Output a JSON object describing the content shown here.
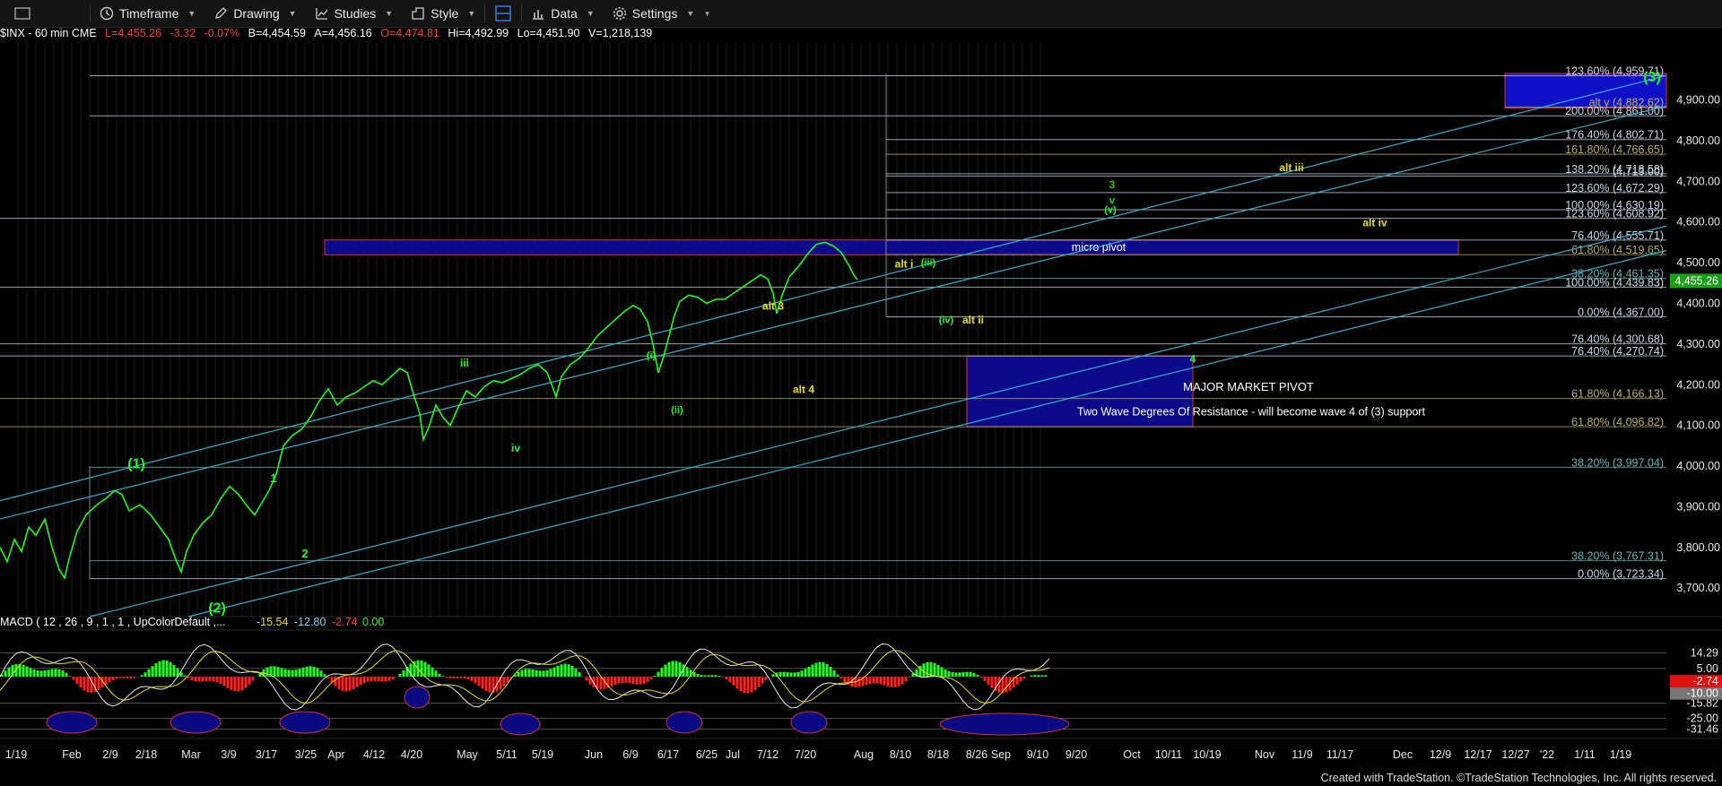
{
  "toolbar": {
    "items": [
      {
        "label": "Timeframe",
        "icon": "clock-icon"
      },
      {
        "label": "Drawing",
        "icon": "pencil-icon"
      },
      {
        "label": "Studies",
        "icon": "studies-icon"
      },
      {
        "label": "Style",
        "icon": "style-icon"
      },
      {
        "label": "Data",
        "icon": "data-icon"
      },
      {
        "label": "Settings",
        "icon": "gear-icon"
      }
    ]
  },
  "header": {
    "symbol": "$INX - 60 min  CME",
    "last": "L=4,455.26",
    "chg": "-3.32",
    "pct": "-0.07%",
    "bid": "B=4,454.59",
    "ask": "A=4,456.16",
    "open": "O=4,474.81",
    "high": "Hi=4,492.99",
    "low": "Lo=4,451.90",
    "vol": "V=1,218,139"
  },
  "macd_header": {
    "title": "MACD ( 12 , 26 , 9 , 1 , 1 , UpColorDefault ,... ",
    "v1": "-15.54",
    "v2": "-12.80",
    "v3": "-2.74",
    "v4": "0.00"
  },
  "footer": "Created with TradeStation. ©TradeStation Technologies, Inc. All rights reserved.",
  "colors": {
    "price": "#19ff19",
    "channel": "#2fb0d0",
    "fib": "#7fd4e0",
    "box": "#0a0a8a",
    "box_border": "#d33",
    "yellow": "#e8e000",
    "macd": "#e8e000"
  },
  "chart_data": {
    "type": "line",
    "title": "$INX - 60 min",
    "y_axis": {
      "ticks": [
        3700,
        3800,
        3900,
        4000,
        4100,
        4200,
        4300,
        4400,
        4500,
        4600,
        4700,
        4800,
        4900
      ],
      "tick_labels": [
        "3,700.00",
        "3,800.00",
        "3,900.00",
        "4,000.00",
        "4,100.00",
        "4,200.00",
        "4,300.00",
        "4,400.00",
        "4,500.00",
        "4,600.00",
        "4,700.00",
        "4,800.00",
        "4,900.00"
      ],
      "range": [
        3630,
        5040
      ],
      "last_price": 4455.26,
      "last_label": "4,455.26"
    },
    "x_axis": {
      "labels": [
        "1/19",
        "Feb",
        "2/9",
        "2/18",
        "Mar",
        "3/9",
        "3/17",
        "3/25",
        "Apr",
        "4/12",
        "4/20",
        "May",
        "5/11",
        "5/19",
        "Jun",
        "6/9",
        "6/17",
        "6/25",
        "Jul",
        "7/12",
        "7/20",
        "Aug",
        "8/10",
        "8/18",
        "8/26",
        "Sep",
        "9/10",
        "9/20",
        "Oct",
        "10/11",
        "10/19",
        "Nov",
        "11/9",
        "11/17",
        "Dec",
        "12/9",
        "12/17",
        "12/27",
        "'22",
        "1/11",
        "1/19"
      ]
    },
    "series": [
      {
        "points": [
          [
            0,
            3800
          ],
          [
            8,
            3765
          ],
          [
            16,
            3820
          ],
          [
            24,
            3790
          ],
          [
            32,
            3850
          ],
          [
            40,
            3830
          ],
          [
            50,
            3870
          ],
          [
            58,
            3800
          ],
          [
            66,
            3745
          ],
          [
            72,
            3725
          ],
          [
            78,
            3780
          ],
          [
            86,
            3840
          ],
          [
            96,
            3880
          ],
          [
            108,
            3905
          ],
          [
            118,
            3920
          ],
          [
            128,
            3940
          ],
          [
            136,
            3930
          ],
          [
            144,
            3890
          ],
          [
            156,
            3905
          ],
          [
            168,
            3880
          ],
          [
            178,
            3850
          ],
          [
            188,
            3820
          ],
          [
            196,
            3770
          ],
          [
            202,
            3740
          ],
          [
            208,
            3790
          ],
          [
            216,
            3830
          ],
          [
            226,
            3860
          ],
          [
            236,
            3880
          ],
          [
            246,
            3920
          ],
          [
            256,
            3950
          ],
          [
            266,
            3930
          ],
          [
            276,
            3900
          ],
          [
            284,
            3880
          ],
          [
            292,
            3910
          ],
          [
            300,
            3940
          ],
          [
            308,
            3980
          ],
          [
            316,
            4050
          ],
          [
            326,
            4075
          ],
          [
            336,
            4090
          ],
          [
            346,
            4120
          ],
          [
            356,
            4160
          ],
          [
            366,
            4190
          ],
          [
            376,
            4150
          ],
          [
            386,
            4170
          ],
          [
            396,
            4180
          ],
          [
            406,
            4195
          ],
          [
            416,
            4210
          ],
          [
            426,
            4200
          ],
          [
            436,
            4220
          ],
          [
            446,
            4240
          ],
          [
            454,
            4230
          ],
          [
            462,
            4170
          ],
          [
            468,
            4130
          ],
          [
            472,
            4065
          ],
          [
            478,
            4095
          ],
          [
            486,
            4150
          ],
          [
            494,
            4120
          ],
          [
            502,
            4100
          ],
          [
            510,
            4140
          ],
          [
            520,
            4185
          ],
          [
            530,
            4170
          ],
          [
            540,
            4195
          ],
          [
            550,
            4210
          ],
          [
            560,
            4205
          ],
          [
            570,
            4215
          ],
          [
            580,
            4225
          ],
          [
            590,
            4240
          ],
          [
            600,
            4250
          ],
          [
            610,
            4230
          ],
          [
            616,
            4195
          ],
          [
            620,
            4170
          ],
          [
            626,
            4220
          ],
          [
            636,
            4250
          ],
          [
            646,
            4265
          ],
          [
            656,
            4290
          ],
          [
            666,
            4320
          ],
          [
            676,
            4340
          ],
          [
            686,
            4360
          ],
          [
            696,
            4380
          ],
          [
            706,
            4395
          ],
          [
            714,
            4385
          ],
          [
            722,
            4355
          ],
          [
            728,
            4300
          ],
          [
            734,
            4230
          ],
          [
            740,
            4270
          ],
          [
            746,
            4320
          ],
          [
            752,
            4370
          ],
          [
            758,
            4405
          ],
          [
            768,
            4420
          ],
          [
            778,
            4415
          ],
          [
            788,
            4400
          ],
          [
            798,
            4410
          ],
          [
            808,
            4410
          ],
          [
            818,
            4425
          ],
          [
            828,
            4440
          ],
          [
            838,
            4455
          ],
          [
            848,
            4470
          ],
          [
            856,
            4460
          ],
          [
            862,
            4425
          ],
          [
            866,
            4375
          ],
          [
            872,
            4420
          ],
          [
            880,
            4465
          ],
          [
            890,
            4490
          ],
          [
            900,
            4520
          ],
          [
            910,
            4545
          ],
          [
            920,
            4550
          ],
          [
            930,
            4540
          ],
          [
            938,
            4525
          ],
          [
            946,
            4495
          ],
          [
            952,
            4470
          ],
          [
            956,
            4458
          ]
        ]
      }
    ],
    "fib_levels": [
      {
        "value": 4959.71,
        "label": "123.60% (4,959.71)"
      },
      {
        "value": 4882.62,
        "label": "alt v (4,882.62)"
      },
      {
        "value": 4861.0,
        "label": "200.00% (4,861.00)"
      },
      {
        "value": 4802.71,
        "label": "176.40% (4,802.71)"
      },
      {
        "value": 4766.65,
        "label": "161.80% (4,766.65)"
      },
      {
        "value": 4718.58,
        "label": "138.20% (4,718.58)"
      },
      {
        "value": 4713.0,
        "label": "(4,713.00)"
      },
      {
        "value": 4672.29,
        "label": "123.60% (4,672.29)"
      },
      {
        "value": 4630.19,
        "label": "100.00% (4,630.19)"
      },
      {
        "value": 4608.92,
        "label": "123.60% (4,608.92)"
      },
      {
        "value": 4555.71,
        "label": "76.40% (4,555.71)"
      },
      {
        "value": 4519.65,
        "label": "61.80% (4,519.65)"
      },
      {
        "value": 4461.35,
        "label": "38.20% (4,461.35)"
      },
      {
        "value": 4439.83,
        "label": "100.00% (4,439.83)"
      },
      {
        "value": 4367.0,
        "label": "0.00% (4,367.00)"
      },
      {
        "value": 4300.68,
        "label": "76.40% (4,300.68)"
      },
      {
        "value": 4270.74,
        "label": "76.40% (4,270.74)"
      },
      {
        "value": 4166.13,
        "label": "61.80% (4,166.13)"
      },
      {
        "value": 4096.82,
        "label": "61.80% (4,096.82)"
      },
      {
        "value": 3997.04,
        "label": "38.20% (3,997.04)"
      },
      {
        "value": 3767.31,
        "label": "38.20% (3,767.31)"
      },
      {
        "value": 3723.34,
        "label": "0.00% (3,723.34)"
      }
    ],
    "annotations": [
      "(1)",
      "(2)",
      "1",
      "2",
      "iii",
      "iv",
      "(i)",
      "(ii)",
      "(iii)",
      "(iv)",
      "(v)",
      "alt 3",
      "alt 4",
      "alt i",
      "alt ii",
      "alt iii",
      "alt iv",
      "3",
      "v",
      "4",
      "(3)"
    ],
    "pivot_boxes": [
      {
        "name": "micro pivot",
        "low": 4519.65,
        "high": 4555.71
      },
      {
        "name": "MAJOR MARKET PIVOT",
        "subtitle": "Two Wave Degrees Of Resistance - will become wave 4 of (3) support",
        "low": 4096.82,
        "high": 4270.74
      },
      {
        "name": "",
        "low": 4880,
        "high": 4965
      }
    ],
    "macd": {
      "ticks": [
        {
          "value": 14.29,
          "label": "14.29"
        },
        {
          "value": 5.0,
          "label": "5.00"
        },
        {
          "value": -15.82,
          "label": "-15.82"
        },
        {
          "value": -25.0,
          "label": "-25.00"
        },
        {
          "value": -31.46,
          "label": "-31.46"
        }
      ],
      "last": {
        "value": -10.0,
        "label": "-10.00"
      },
      "hist_last": {
        "value": -2.74,
        "label": "-2.74"
      },
      "range": [
        -36,
        28
      ]
    }
  }
}
